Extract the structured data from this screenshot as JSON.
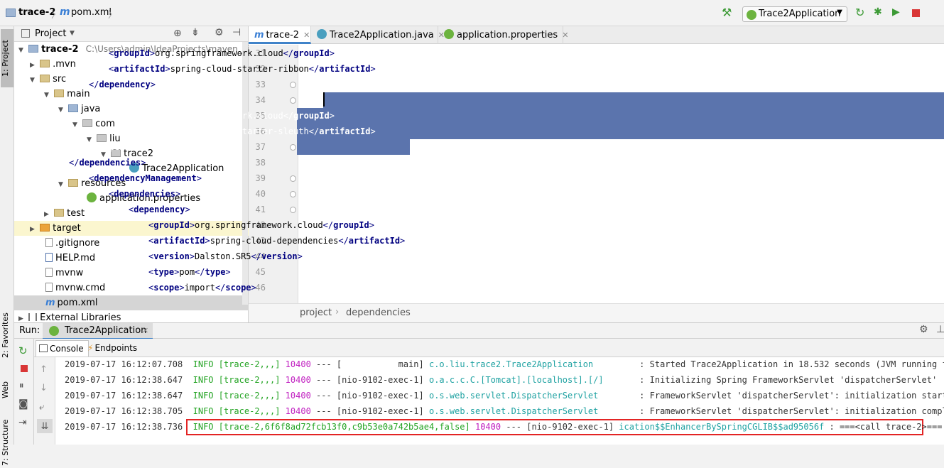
{
  "navbar": {
    "project": "trace-2",
    "file": "pom.xml",
    "run_config": "Trace2Application"
  },
  "left_strip": {
    "project_tab": "1: Project",
    "favorites_tab": "2: Favorites",
    "web_tab": "Web",
    "structure_tab": "7: Structure"
  },
  "project_panel": {
    "title": "Project",
    "tree": [
      {
        "label": "trace-2",
        "path": "C:\\Users\\admin\\IdeaProjects\\maven_distr"
      },
      {
        "label": ".mvn"
      },
      {
        "label": "src"
      },
      {
        "label": "main"
      },
      {
        "label": "java"
      },
      {
        "label": "com"
      },
      {
        "label": "liu"
      },
      {
        "label": "trace2"
      },
      {
        "label": "Trace2Application"
      },
      {
        "label": "resources"
      },
      {
        "label": "application.properties"
      },
      {
        "label": "test"
      },
      {
        "label": "target"
      },
      {
        "label": ".gitignore"
      },
      {
        "label": "HELP.md"
      },
      {
        "label": "mvnw"
      },
      {
        "label": "mvnw.cmd"
      },
      {
        "label": "pom.xml"
      },
      {
        "label": "External Libraries"
      }
    ]
  },
  "editor": {
    "tabs": [
      {
        "label": "trace-2"
      },
      {
        "label": "Trace2Application.java"
      },
      {
        "label": "application.properties"
      }
    ],
    "lines": [
      {
        "n": "31",
        "open": "groupId",
        "text": "org.springframework.cloud"
      },
      {
        "n": "32",
        "open": "artifactId",
        "text": "spring-cloud-starter-ribbon"
      },
      {
        "n": "33",
        "close": "dependency"
      },
      {
        "n": "34",
        "open_only": "dependency"
      },
      {
        "n": "35",
        "open": "groupId",
        "text": "org.springframework.cloud"
      },
      {
        "n": "36",
        "open": "artifactId",
        "text": "spring-cloud-starter-sleuth"
      },
      {
        "n": "37",
        "close": "dependency"
      },
      {
        "n": "38",
        "close": "dependencies"
      },
      {
        "n": "39",
        "open_only": "dependencyManagement"
      },
      {
        "n": "40",
        "open_only": "dependencies"
      },
      {
        "n": "41",
        "open_only": "dependency"
      },
      {
        "n": "42",
        "open": "groupId",
        "text": "org.springframework.cloud"
      },
      {
        "n": "43",
        "open": "artifactId",
        "text": "spring-cloud-dependencies"
      },
      {
        "n": "44",
        "open": "version",
        "text": "Dalston.SR5"
      },
      {
        "n": "45",
        "open": "type",
        "text": "pom"
      },
      {
        "n": "46",
        "open": "scope",
        "text": "import"
      }
    ],
    "breadcrumb": [
      "project",
      "dependencies"
    ]
  },
  "run": {
    "label": "Run:",
    "config": "Trace2Application",
    "tabs": [
      "Console",
      "Endpoints"
    ],
    "log": [
      {
        "date": "2019-07-17 16:12:07.708",
        "level": "INFO",
        "trace": "[trace-2,,,]",
        "pid": "10400",
        "sep": "---",
        "thread": "[           main]",
        "logger": "c.o.liu.trace2.Trace2Application        ",
        "msg": ": Started Trace2Application in 18.532 seconds (JVM running for 20"
      },
      {
        "date": "2019-07-17 16:12:38.647",
        "level": "INFO",
        "trace": "[trace-2,,,]",
        "pid": "10400",
        "sep": "---",
        "thread": "[nio-9102-exec-1]",
        "logger": "o.a.c.c.C.[Tomcat].[localhost].[/]      ",
        "msg": ": Initializing Spring FrameworkServlet 'dispatcherServlet'"
      },
      {
        "date": "2019-07-17 16:12:38.647",
        "level": "INFO",
        "trace": "[trace-2,,,]",
        "pid": "10400",
        "sep": "---",
        "thread": "[nio-9102-exec-1]",
        "logger": "o.s.web.servlet.DispatcherServlet       ",
        "msg": ": FrameworkServlet 'dispatcherServlet': initialization started"
      },
      {
        "date": "2019-07-17 16:12:38.705",
        "level": "INFO",
        "trace": "[trace-2,,,]",
        "pid": "10400",
        "sep": "---",
        "thread": "[nio-9102-exec-1]",
        "logger": "o.s.web.servlet.DispatcherServlet       ",
        "msg": ": FrameworkServlet 'dispatcherServlet': initialization completed"
      },
      {
        "date": "2019-07-17 16:12:38.736",
        "level": "INFO",
        "trace": "[trace-2,6f6f8ad72fcb13f0,c9b53e0a742b5ae4,false]",
        "pid": "10400",
        "sep": "---",
        "thread": "[nio-9102-exec-1]",
        "logger": "ication$$EnhancerBySpringCGLIB$$ad95056f",
        "msg": ": ===<call trace-2>==="
      }
    ]
  },
  "colors": {
    "selection": "#5b74ad",
    "xml_tag": "#000080",
    "log_info": "#22a322",
    "log_pid": "#c01ec0",
    "log_logger": "#1fa2a2",
    "highlight_box": "#e32424"
  }
}
